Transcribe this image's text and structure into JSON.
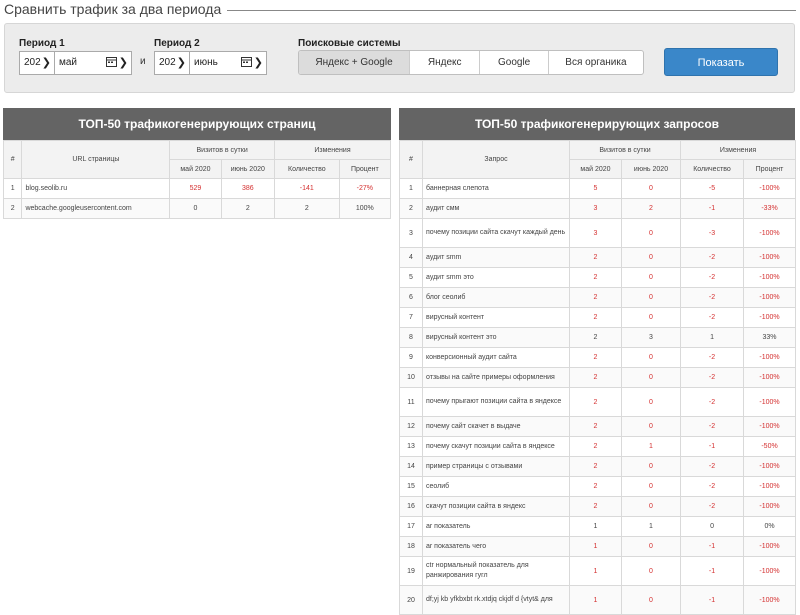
{
  "header": {
    "title": "Сравнить трафик за два периода"
  },
  "filter": {
    "period1": {
      "label": "Период 1",
      "year": "202",
      "month": "май"
    },
    "separator": "и",
    "period2": {
      "label": "Период 2",
      "year": "202",
      "month": "июнь"
    },
    "engines": {
      "label": "Поисковые системы",
      "options": [
        "Яндекс + Google",
        "Яндекс",
        "Google",
        "Вся органика"
      ],
      "active_index": 0
    },
    "show_button": "Показать"
  },
  "pages": {
    "title": "ТОП-50 трафикогенерирующих страниц",
    "headers": {
      "num": "#",
      "url": "URL страницы",
      "visits": "Визитов в сутки",
      "changes": "Изменения",
      "m1": "май 2020",
      "m2": "июнь 2020",
      "qty": "Количество",
      "pct": "Процент"
    },
    "rows": [
      {
        "n": "1",
        "url": "blog.seolib.ru",
        "a": "529",
        "b": "386",
        "d": "-141",
        "p": "-27%",
        "neg": true
      },
      {
        "n": "2",
        "url": "webcache.googleusercontent.com",
        "a": "0",
        "b": "2",
        "d": "2",
        "p": "100%",
        "neg": false
      }
    ]
  },
  "queries": {
    "title": "ТОП-50 трафикогенерирующих запросов",
    "headers": {
      "num": "#",
      "q": "Запрос",
      "visits": "Визитов в сутки",
      "changes": "Изменения",
      "m1": "май 2020",
      "m2": "июнь 2020",
      "qty": "Количество",
      "pct": "Процент"
    },
    "rows": [
      {
        "n": "1",
        "q": "баннерная слепота",
        "a": "5",
        "b": "0",
        "d": "-5",
        "p": "-100%",
        "neg": true
      },
      {
        "n": "2",
        "q": "аудит смм",
        "a": "3",
        "b": "2",
        "d": "-1",
        "p": "-33%",
        "neg": true
      },
      {
        "n": "3",
        "q": "почему позиции сайта скачут каждый день",
        "a": "3",
        "b": "0",
        "d": "-3",
        "p": "-100%",
        "neg": true
      },
      {
        "n": "4",
        "q": "аудит smm",
        "a": "2",
        "b": "0",
        "d": "-2",
        "p": "-100%",
        "neg": true
      },
      {
        "n": "5",
        "q": "аудит smm это",
        "a": "2",
        "b": "0",
        "d": "-2",
        "p": "-100%",
        "neg": true
      },
      {
        "n": "6",
        "q": "блог сеолиб",
        "a": "2",
        "b": "0",
        "d": "-2",
        "p": "-100%",
        "neg": true
      },
      {
        "n": "7",
        "q": "вирусный контент",
        "a": "2",
        "b": "0",
        "d": "-2",
        "p": "-100%",
        "neg": true
      },
      {
        "n": "8",
        "q": "вирусный контент это",
        "a": "2",
        "b": "3",
        "d": "1",
        "p": "33%",
        "neg": false
      },
      {
        "n": "9",
        "q": "конверсионный аудит сайта",
        "a": "2",
        "b": "0",
        "d": "-2",
        "p": "-100%",
        "neg": true
      },
      {
        "n": "10",
        "q": "отзывы на сайте примеры оформления",
        "a": "2",
        "b": "0",
        "d": "-2",
        "p": "-100%",
        "neg": true
      },
      {
        "n": "11",
        "q": "почему прыгают позиции сайта в яндексе",
        "a": "2",
        "b": "0",
        "d": "-2",
        "p": "-100%",
        "neg": true
      },
      {
        "n": "12",
        "q": "почему сайт скачет в выдаче",
        "a": "2",
        "b": "0",
        "d": "-2",
        "p": "-100%",
        "neg": true
      },
      {
        "n": "13",
        "q": "почему скачут позиции сайта в яндексе",
        "a": "2",
        "b": "1",
        "d": "-1",
        "p": "-50%",
        "neg": true
      },
      {
        "n": "14",
        "q": "пример страницы с отзывами",
        "a": "2",
        "b": "0",
        "d": "-2",
        "p": "-100%",
        "neg": true
      },
      {
        "n": "15",
        "q": "сеолиб",
        "a": "2",
        "b": "0",
        "d": "-2",
        "p": "-100%",
        "neg": true
      },
      {
        "n": "16",
        "q": "скачут позиции сайта в яндекс",
        "a": "2",
        "b": "0",
        "d": "-2",
        "p": "-100%",
        "neg": true
      },
      {
        "n": "17",
        "q": "ar показатель",
        "a": "1",
        "b": "1",
        "d": "0",
        "p": "0%",
        "neg": false
      },
      {
        "n": "18",
        "q": "ar показатель чего",
        "a": "1",
        "b": "0",
        "d": "-1",
        "p": "-100%",
        "neg": true
      },
      {
        "n": "19",
        "q": "ctr нормальный показатель для ранжирования гугл",
        "a": "1",
        "b": "0",
        "d": "-1",
        "p": "-100%",
        "neg": true
      },
      {
        "n": "20",
        "q": "df;yj kb yfkbxbt rk.xtdjq ckjdf d {vtyt& для",
        "a": "1",
        "b": "0",
        "d": "-1",
        "p": "-100%",
        "neg": true
      }
    ]
  },
  "colors": {
    "accent": "#3a87c9",
    "negative": "#d43030",
    "panel_header": "#646464"
  }
}
